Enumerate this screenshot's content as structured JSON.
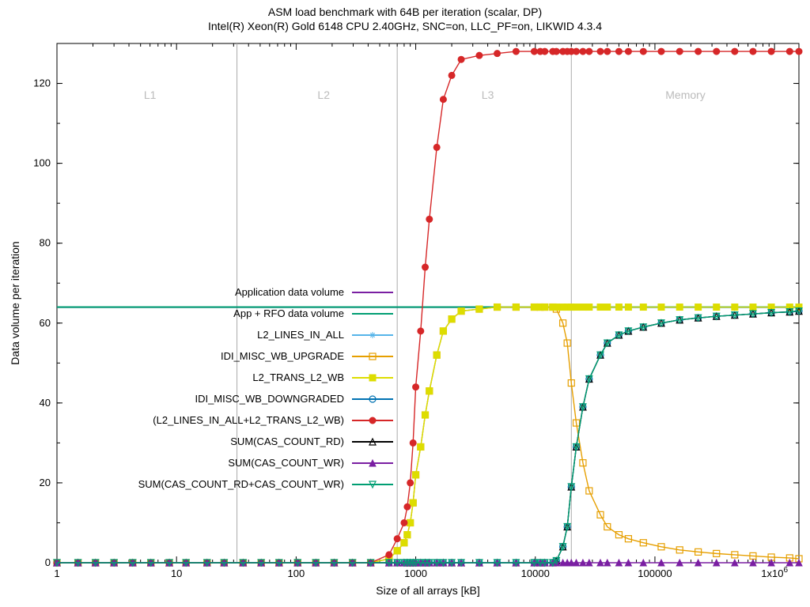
{
  "chart_data": {
    "type": "line",
    "title": "ASM load benchmark with 64B per iteration (scalar, DP)",
    "subtitle": "Intel(R) Xeon(R) Gold 6148 CPU 2.40GHz, SNC=on, LLC_PF=on, LIKWID 4.3.4",
    "xlabel": "Size of all arrays [kB]",
    "ylabel": "Data volume per iteration",
    "x_log": true,
    "xlim": [
      1,
      1600000
    ],
    "ylim": [
      0,
      130
    ],
    "yticks": [
      0,
      20,
      40,
      60,
      80,
      100,
      120
    ],
    "xticks_major": [
      1,
      10,
      100,
      1000,
      10000,
      100000,
      1000000
    ],
    "xtick_labels": [
      "1",
      "10",
      "100",
      "1000",
      "10000",
      "100000",
      "1x10^6"
    ],
    "regions": [
      {
        "label": "L1",
        "x": 6,
        "boundary": 32
      },
      {
        "label": "L2",
        "x": 170,
        "boundary": 700
      },
      {
        "label": "L3",
        "x": 4000,
        "boundary": 20000
      },
      {
        "label": "Memory",
        "x": 180000,
        "boundary": null
      }
    ],
    "x": [
      1,
      1.5,
      2.1,
      3,
      4.3,
      6.1,
      8.7,
      12,
      18,
      25,
      36,
      51,
      72,
      103,
      146,
      208,
      296,
      420,
      598,
      700,
      800,
      850,
      900,
      950,
      1000,
      1100,
      1200,
      1300,
      1500,
      1700,
      2000,
      2400,
      3400,
      4800,
      6900,
      9800,
      11000,
      12000,
      14000,
      15000,
      17000,
      18500,
      20000,
      22000,
      25000,
      28200,
      35000,
      40000,
      50000,
      60000,
      80000,
      113000,
      161000,
      230000,
      327000,
      465000,
      661000,
      940000,
      1339000,
      1600000
    ],
    "series": [
      {
        "name": "Application data volume",
        "color": "#7a1fa2",
        "marker": "none",
        "const": 64
      },
      {
        "name": "App + RFO data volume",
        "color": "#009e73",
        "marker": "none",
        "const": 64
      },
      {
        "name": "L2_LINES_IN_ALL",
        "color": "#56b4e9",
        "marker": "asterisk",
        "values": [
          0,
          0,
          0,
          0,
          0,
          0,
          0,
          0,
          0,
          0,
          0,
          0,
          0,
          0,
          0,
          0,
          0,
          0,
          1,
          3,
          5,
          7,
          10,
          15,
          22,
          29,
          37,
          43,
          52,
          58,
          61,
          63,
          63.5,
          64,
          64,
          64,
          64,
          64,
          64,
          64,
          64,
          64,
          64,
          64,
          64,
          64,
          64,
          64,
          64,
          64,
          64,
          64,
          64,
          64,
          64,
          64,
          64,
          64,
          64,
          64
        ]
      },
      {
        "name": "IDI_MISC_WB_UPGRADE",
        "color": "#e69f00",
        "marker": "square-open",
        "values": [
          0,
          0,
          0,
          0,
          0,
          0,
          0,
          0,
          0,
          0,
          0,
          0,
          0,
          0,
          0,
          0,
          0,
          0,
          1,
          3,
          5,
          7,
          10,
          15,
          22,
          29,
          37,
          43,
          52,
          58,
          61,
          63,
          63.5,
          64,
          64,
          64,
          64,
          64,
          64,
          63.5,
          60,
          55,
          45,
          35,
          25,
          18,
          12,
          9,
          7,
          6,
          5,
          4,
          3.2,
          2.7,
          2.3,
          2,
          1.7,
          1.4,
          1.2,
          1
        ]
      },
      {
        "name": "L2_TRANS_L2_WB",
        "color": "#dddd00",
        "marker": "square-filled",
        "values": [
          0,
          0,
          0,
          0,
          0,
          0,
          0,
          0,
          0,
          0,
          0,
          0,
          0,
          0,
          0,
          0,
          0,
          0,
          1,
          3,
          5,
          7,
          10,
          15,
          22,
          29,
          37,
          43,
          52,
          58,
          61,
          63,
          63.5,
          64,
          64,
          64,
          64,
          64,
          64,
          64,
          64,
          64,
          64,
          64,
          64,
          64,
          64,
          64,
          64,
          64,
          64,
          64,
          64,
          64,
          64,
          64,
          64,
          64,
          64,
          64
        ]
      },
      {
        "name": "IDI_MISC_WB_DOWNGRADED",
        "color": "#0072b2",
        "marker": "circle-open",
        "values": [
          0,
          0,
          0,
          0,
          0,
          0,
          0,
          0,
          0,
          0,
          0,
          0,
          0,
          0,
          0,
          0,
          0,
          0,
          0,
          0,
          0,
          0,
          0,
          0,
          0,
          0,
          0,
          0,
          0,
          0,
          0,
          0,
          0,
          0,
          0,
          0,
          0,
          0,
          0,
          0.5,
          4,
          9,
          19,
          29,
          39,
          46,
          52,
          55,
          57,
          58,
          59,
          60,
          60.8,
          61.3,
          61.7,
          62,
          62.3,
          62.6,
          62.8,
          63
        ]
      },
      {
        "name": "(L2_LINES_IN_ALL+L2_TRANS_L2_WB)",
        "color": "#d62728",
        "marker": "circle-filled",
        "values": [
          0,
          0,
          0,
          0,
          0,
          0,
          0,
          0,
          0,
          0,
          0,
          0,
          0,
          0,
          0,
          0,
          0,
          0,
          2,
          6,
          10,
          14,
          20,
          30,
          44,
          58,
          74,
          86,
          104,
          116,
          122,
          126,
          127,
          127.5,
          128,
          128,
          128,
          128,
          128,
          128,
          128,
          128,
          128,
          128,
          128,
          128,
          128,
          128,
          128,
          128,
          128,
          128,
          128,
          128,
          128,
          128,
          128,
          128,
          128,
          128
        ]
      },
      {
        "name": "SUM(CAS_COUNT_RD)",
        "color": "#000000",
        "marker": "triangle-open",
        "values": [
          0,
          0,
          0,
          0,
          0,
          0,
          0,
          0,
          0,
          0,
          0,
          0,
          0,
          0,
          0,
          0,
          0,
          0,
          0,
          0,
          0,
          0,
          0,
          0,
          0,
          0,
          0,
          0,
          0,
          0,
          0,
          0,
          0,
          0,
          0,
          0,
          0,
          0,
          0,
          0.5,
          4,
          9,
          19,
          29,
          39,
          46,
          52,
          55,
          57,
          58,
          59,
          60,
          60.8,
          61.3,
          61.7,
          62,
          62.3,
          62.6,
          62.8,
          63
        ]
      },
      {
        "name": "SUM(CAS_COUNT_WR)",
        "color": "#7a1fa2",
        "marker": "triangle-filled",
        "values": [
          0,
          0,
          0,
          0,
          0,
          0,
          0,
          0,
          0,
          0,
          0,
          0,
          0,
          0,
          0,
          0,
          0,
          0,
          0,
          0,
          0,
          0,
          0,
          0,
          0,
          0,
          0,
          0,
          0,
          0,
          0,
          0,
          0,
          0,
          0,
          0,
          0,
          0,
          0,
          0,
          0,
          0,
          0,
          0,
          0,
          0,
          0,
          0,
          0,
          0,
          0,
          0,
          0,
          0,
          0,
          0,
          0,
          0,
          0,
          0
        ]
      },
      {
        "name": "SUM(CAS_COUNT_RD+CAS_COUNT_WR)",
        "color": "#009e73",
        "marker": "triangle-down-open",
        "values": [
          0,
          0,
          0,
          0,
          0,
          0,
          0,
          0,
          0,
          0,
          0,
          0,
          0,
          0,
          0,
          0,
          0,
          0,
          0,
          0,
          0,
          0,
          0,
          0,
          0,
          0,
          0,
          0,
          0,
          0,
          0,
          0,
          0,
          0,
          0,
          0,
          0,
          0,
          0,
          0.5,
          4,
          9,
          19,
          29,
          39,
          46,
          52,
          55,
          57,
          58,
          59,
          60,
          60.8,
          61.3,
          61.7,
          62,
          62.3,
          62.6,
          62.8,
          63
        ]
      }
    ],
    "legend_pos": {
      "x": 435,
      "y0": 370,
      "dy": 27
    }
  }
}
